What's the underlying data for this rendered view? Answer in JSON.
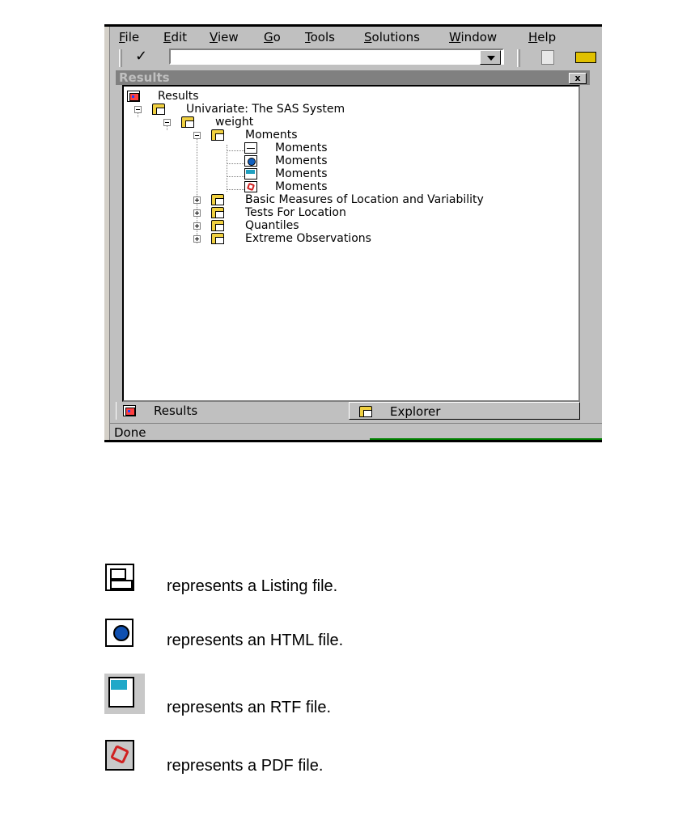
{
  "menu": [
    {
      "first": "F",
      "rest": "ile"
    },
    {
      "first": "E",
      "rest": "dit"
    },
    {
      "first": "V",
      "rest": "iew"
    },
    {
      "first": "G",
      "rest": "o"
    },
    {
      "first": "T",
      "rest": "ools"
    },
    {
      "first": "S",
      "rest": "olutions"
    },
    {
      "first": "W",
      "rest": "indow"
    },
    {
      "first": "H",
      "rest": "elp"
    }
  ],
  "toolbar": {
    "check_glyph": "✓",
    "command_value": ""
  },
  "window": {
    "title": "Results",
    "close_glyph": "x"
  },
  "tree": {
    "root": "Results",
    "proc": "Univariate:  The SAS System",
    "variable": "weight",
    "group_open": "Moments",
    "children": [
      "Moments",
      "Moments",
      "Moments",
      "Moments"
    ],
    "groups": [
      "Basic Measures of Location and Variability",
      "Tests For Location",
      "Quantiles",
      "Extreme Observations"
    ]
  },
  "tabs": {
    "results": "Results",
    "explorer": "Explorer"
  },
  "status": {
    "text": "Done"
  },
  "legend": [
    {
      "icon": "listing-file-icon",
      "text": "represents a Listing file."
    },
    {
      "icon": "html-file-icon",
      "text": "represents an HTML file."
    },
    {
      "icon": "rtf-file-icon",
      "text": "represents an RTF file."
    },
    {
      "icon": "pdf-file-icon",
      "text": "represents a PDF file."
    }
  ]
}
